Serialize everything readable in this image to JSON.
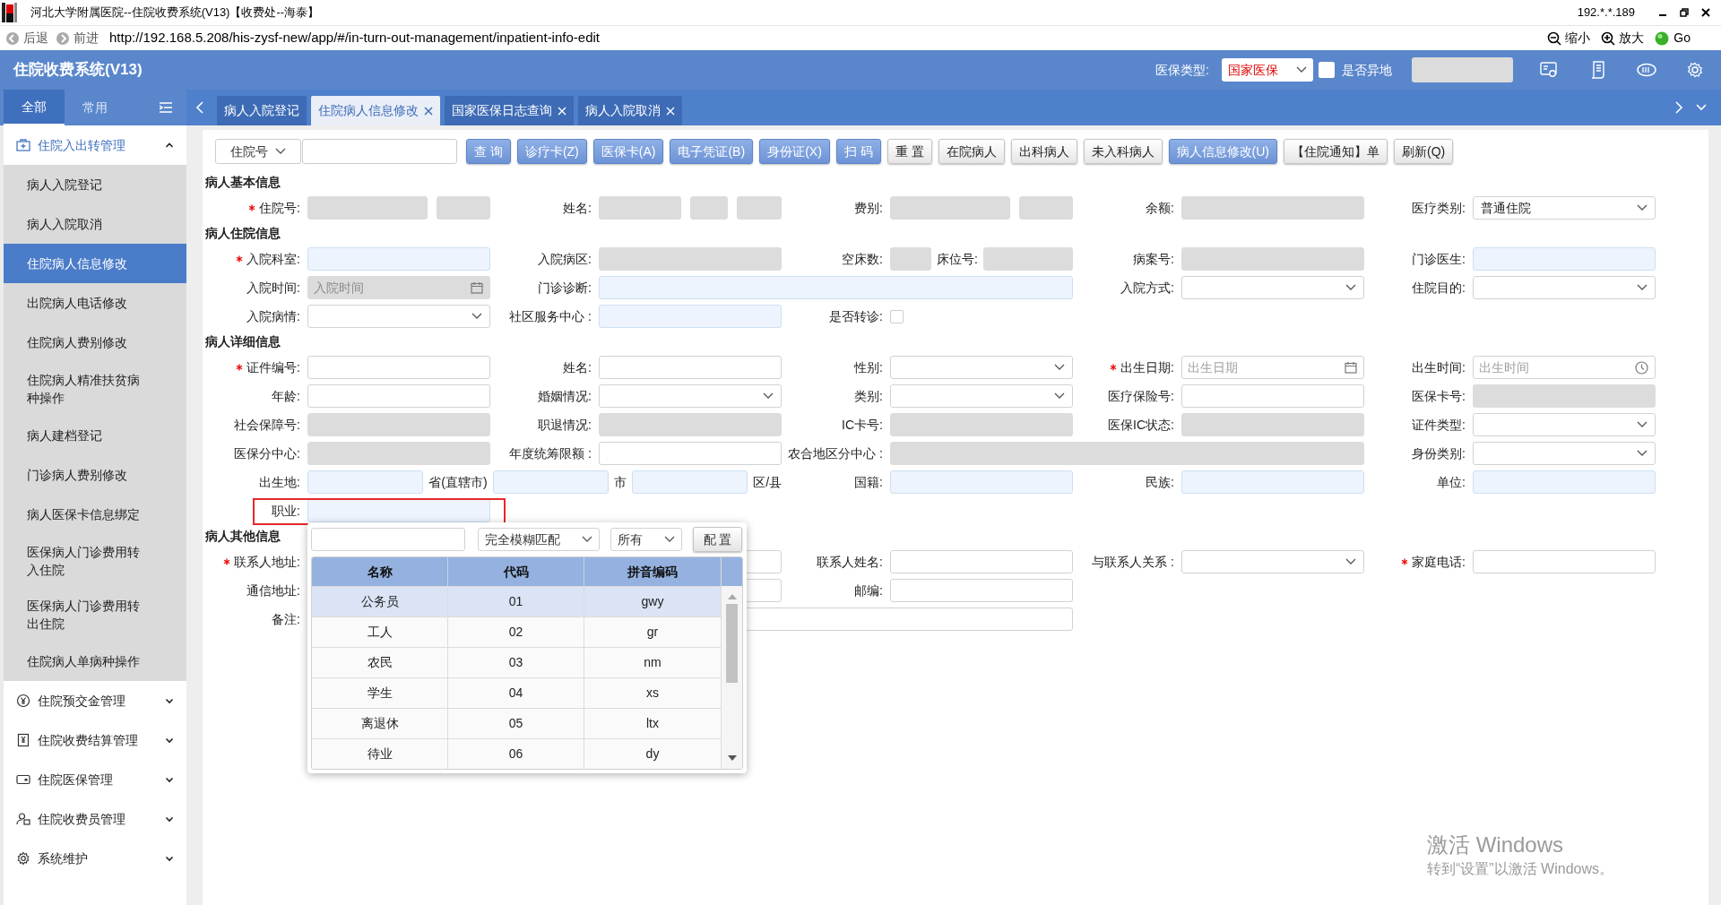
{
  "window": {
    "title": "河北大学附属医院--住院收费系统(V13)【收费处--海泰】",
    "ip": "192.*.*.189"
  },
  "browser": {
    "back": "后退",
    "forward": "前进",
    "url": "http://192.168.5.208/his-zysf-new/app/#/in-turn-out-management/inpatient-info-edit",
    "zoom_out": "缩小",
    "zoom_in": "放大",
    "go": "Go"
  },
  "app": {
    "title": "住院收费系统(V13)",
    "insurance_label": "医保类型:",
    "insurance_value": "国家医保",
    "remote_label": "是否异地",
    "remote_checked": false
  },
  "sidebar": {
    "tabs": [
      {
        "label": "全部",
        "selected": true
      },
      {
        "label": "常用",
        "selected": false
      }
    ],
    "groups": [
      {
        "label": "住院入出转管理",
        "expanded": true,
        "items": [
          {
            "label": "病人入院登记",
            "selected": false
          },
          {
            "label": "病人入院取消",
            "selected": false
          },
          {
            "label": "住院病人信息修改",
            "selected": true
          },
          {
            "label": "出院病人电话修改",
            "selected": false
          },
          {
            "label": "住院病人费别修改",
            "selected": false
          },
          {
            "label": "住院病人精准扶贫病种操作",
            "selected": false
          },
          {
            "label": "病人建档登记",
            "selected": false
          },
          {
            "label": "门诊病人费别修改",
            "selected": false
          },
          {
            "label": "病人医保卡信息绑定",
            "selected": false
          },
          {
            "label": "医保病人门诊费用转入住院",
            "selected": false
          },
          {
            "label": "医保病人门诊费用转出住院",
            "selected": false
          },
          {
            "label": "住院病人单病种操作",
            "selected": false
          }
        ]
      },
      {
        "label": "住院预交金管理",
        "expanded": false
      },
      {
        "label": "住院收费结算管理",
        "expanded": false
      },
      {
        "label": "住院医保管理",
        "expanded": false
      },
      {
        "label": "住院收费员管理",
        "expanded": false
      },
      {
        "label": "系统维护",
        "expanded": false
      }
    ]
  },
  "tabs": [
    {
      "label": "病人入院登记",
      "selected": false,
      "closable": false
    },
    {
      "label": "住院病人信息修改",
      "selected": true,
      "closable": true
    },
    {
      "label": "国家医保日志查询",
      "selected": false,
      "closable": true
    },
    {
      "label": "病人入院取消",
      "selected": false,
      "closable": true
    }
  ],
  "toolbar": {
    "search_by": "住院号",
    "buttons": [
      {
        "label": "查 询",
        "kind": "primary"
      },
      {
        "label": "诊疗卡(Z)",
        "kind": "primary"
      },
      {
        "label": "医保卡(A)",
        "kind": "primary"
      },
      {
        "label": "电子凭证(B)",
        "kind": "primary"
      },
      {
        "label": "身份证(X)",
        "kind": "primary"
      },
      {
        "label": "扫 码",
        "kind": "primary"
      },
      {
        "label": "重 置",
        "kind": "default"
      },
      {
        "label": "在院病人",
        "kind": "default"
      },
      {
        "label": "出科病人",
        "kind": "default"
      },
      {
        "label": "未入科病人",
        "kind": "default"
      },
      {
        "label": "病人信息修改(U)",
        "kind": "primary"
      },
      {
        "label": "【住院通知】单",
        "kind": "default"
      },
      {
        "label": "刷新(Q)",
        "kind": "default"
      }
    ]
  },
  "form": {
    "sections": [
      {
        "title": "病人基本信息",
        "rows": [
          [
            {
              "label": "住院号:",
              "required": true,
              "fields": [
                {
                  "kind": "input",
                  "disabled": true
                },
                {
                  "kind": "input",
                  "disabled": true
                }
              ]
            },
            {
              "label": "姓名:",
              "required": false,
              "fields": [
                {
                  "kind": "input",
                  "disabled": true
                },
                {
                  "kind": "input",
                  "disabled": true
                },
                {
                  "kind": "input",
                  "disabled": true
                }
              ]
            },
            {
              "label": "费别:",
              "required": false,
              "fields": [
                {
                  "kind": "input",
                  "disabled": true
                },
                {
                  "kind": "input",
                  "disabled": true
                }
              ]
            },
            {
              "label": "余额:",
              "required": false,
              "fields": [
                {
                  "kind": "input",
                  "disabled": true
                }
              ]
            },
            {
              "label": "医疗类别:",
              "required": false,
              "fields": [
                {
                  "kind": "select",
                  "value": "普通住院"
                }
              ]
            }
          ]
        ]
      },
      {
        "title": "病人住院信息",
        "rows": [
          [
            {
              "label": "入院科室:",
              "required": true,
              "fields": [
                {
                  "kind": "lookup"
                }
              ]
            },
            {
              "label": "入院病区:",
              "required": false,
              "fields": [
                {
                  "kind": "input",
                  "disabled": true
                }
              ]
            },
            {
              "label": "空床数:",
              "required": false,
              "fields": [
                {
                  "kind": "input",
                  "disabled": true
                },
                {
                  "kind": "text",
                  "text": "床位号:"
                },
                {
                  "kind": "input",
                  "disabled": true
                }
              ]
            },
            {
              "label": "病案号:",
              "required": false,
              "fields": [
                {
                  "kind": "input",
                  "disabled": true
                }
              ]
            },
            {
              "label": "门诊医生:",
              "required": false,
              "fields": [
                {
                  "kind": "lookup"
                }
              ]
            }
          ],
          [
            {
              "label": "入院时间:",
              "required": false,
              "fields": [
                {
                  "kind": "date",
                  "placeholder": "入院时间",
                  "disabled": true
                }
              ]
            },
            {
              "label": "门诊诊断:",
              "required": false,
              "fields": [
                {
                  "kind": "lookup"
                }
              ]
            },
            "",
            {
              "label": "入院方式:",
              "required": false,
              "fields": [
                {
                  "kind": "select"
                }
              ]
            },
            {
              "label": "住院目的:",
              "required": false,
              "fields": [
                {
                  "kind": "select"
                }
              ]
            }
          ],
          [
            {
              "label": "入院病情:",
              "required": false,
              "fields": [
                {
                  "kind": "select"
                }
              ]
            },
            {
              "label": "社区服务中心 :",
              "required": false,
              "fields": [
                {
                  "kind": "lookup"
                }
              ]
            },
            {
              "label": "是否转诊:",
              "required": false,
              "fields": [
                {
                  "kind": "checkbox",
                  "checked": false
                }
              ]
            }
          ]
        ]
      },
      {
        "title": "病人详细信息",
        "rows": [
          [
            {
              "label": "证件编号:",
              "required": true,
              "fields": [
                {
                  "kind": "input"
                }
              ]
            },
            {
              "label": "姓名:",
              "required": false,
              "fields": [
                {
                  "kind": "input"
                }
              ]
            },
            {
              "label": "性别:",
              "required": false,
              "fields": [
                {
                  "kind": "select"
                }
              ]
            },
            {
              "label": "出生日期:",
              "required": true,
              "fields": [
                {
                  "kind": "date",
                  "placeholder": "出生日期",
                  "disabled": false
                }
              ]
            },
            {
              "label": "出生时间:",
              "required": false,
              "fields": [
                {
                  "kind": "time",
                  "placeholder": "出生时间",
                  "disabled": false
                }
              ]
            }
          ],
          [
            {
              "label": "年龄:",
              "required": false,
              "fields": [
                {
                  "kind": "input"
                }
              ]
            },
            {
              "label": "婚姻情况:",
              "required": false,
              "fields": [
                {
                  "kind": "select"
                }
              ]
            },
            {
              "label": "类别:",
              "required": false,
              "fields": [
                {
                  "kind": "select"
                }
              ]
            },
            {
              "label": "医疗保险号:",
              "required": false,
              "fields": [
                {
                  "kind": "input"
                }
              ]
            },
            {
              "label": "医保卡号:",
              "required": false,
              "fields": [
                {
                  "kind": "input",
                  "disabled": true
                }
              ]
            }
          ],
          [
            {
              "label": "社会保障号:",
              "required": false,
              "fields": [
                {
                  "kind": "input",
                  "disabled": true
                }
              ]
            },
            {
              "label": "职退情况:",
              "required": false,
              "fields": [
                {
                  "kind": "input",
                  "disabled": true
                }
              ]
            },
            {
              "label": "IC卡号:",
              "required": false,
              "fields": [
                {
                  "kind": "input",
                  "disabled": true
                }
              ]
            },
            {
              "label": "医保IC状态:",
              "required": false,
              "fields": [
                {
                  "kind": "input",
                  "disabled": true
                }
              ]
            },
            {
              "label": "证件类型:",
              "required": false,
              "fields": [
                {
                  "kind": "select"
                }
              ]
            }
          ],
          [
            {
              "label": "医保分中心:",
              "required": false,
              "fields": [
                {
                  "kind": "input",
                  "disabled": true
                }
              ]
            },
            {
              "label": "年度统筹限额 :",
              "required": false,
              "fields": [
                {
                  "kind": "input"
                }
              ]
            },
            {
              "label": "农合地区分中心 :",
              "required": false,
              "fields": [
                {
                  "kind": "input",
                  "disabled": true
                }
              ]
            },
            "",
            {
              "label": "身份类别:",
              "required": false,
              "fields": [
                {
                  "kind": "select"
                }
              ]
            }
          ],
          [
            {
              "label": "出生地:",
              "required": false,
              "fields": [
                {
                  "kind": "lookup"
                },
                {
                  "kind": "text",
                  "text": "省(直辖市)"
                },
                {
                  "kind": "lookup"
                },
                {
                  "kind": "text",
                  "text": "市"
                },
                {
                  "kind": "lookup"
                },
                {
                  "kind": "text",
                  "text": "区/县"
                }
              ]
            },
            "",
            {
              "label": "国籍:",
              "required": false,
              "fields": [
                {
                  "kind": "lookup"
                }
              ]
            },
            {
              "label": "民族:",
              "required": false,
              "fields": [
                {
                  "kind": "lookup"
                }
              ]
            },
            {
              "label": "单位:",
              "required": false,
              "fields": [
                {
                  "kind": "lookup"
                }
              ]
            }
          ],
          [
            {
              "label": "职业:",
              "required": false,
              "highlighted": true,
              "fields": [
                {
                  "kind": "lookup"
                }
              ]
            }
          ]
        ]
      },
      {
        "title": "病人其他信息",
        "rows": [
          [
            {
              "label": "联系人地址:",
              "required": true,
              "fields": [
                {
                  "kind": "input"
                }
              ]
            },
            "",
            {
              "label": "联系人姓名:",
              "required": false,
              "fields": [
                {
                  "kind": "input"
                }
              ]
            },
            {
              "label": "与联系人关系 :",
              "required": false,
              "fields": [
                {
                  "kind": "select"
                }
              ]
            },
            {
              "label": "家庭电话:",
              "required": true,
              "fields": [
                {
                  "kind": "input"
                }
              ]
            }
          ],
          [
            {
              "label": "通信地址:",
              "required": false,
              "fields": [
                {
                  "kind": "input"
                }
              ]
            },
            "",
            {
              "label": "邮编:",
              "required": false,
              "fields": [
                {
                  "kind": "input"
                }
              ]
            }
          ],
          [
            {
              "label": "备注:",
              "required": false,
              "fields": [
                {
                  "kind": "input"
                }
              ]
            },
            "",
            ""
          ]
        ]
      }
    ]
  },
  "popup": {
    "match_mode": "完全模糊匹配",
    "scope": "所有",
    "config_button": "配 置",
    "columns": [
      "名称",
      "代码",
      "拼音编码"
    ],
    "rows": [
      {
        "cells": [
          "公务员",
          "01",
          "gwy"
        ],
        "selected": true
      },
      {
        "cells": [
          "工人",
          "02",
          "gr"
        ],
        "selected": false
      },
      {
        "cells": [
          "农民",
          "03",
          "nm"
        ],
        "selected": false
      },
      {
        "cells": [
          "学生",
          "04",
          "xs"
        ],
        "selected": false
      },
      {
        "cells": [
          "离退休",
          "05",
          "ltx"
        ],
        "selected": false
      },
      {
        "cells": [
          "待业",
          "06",
          "dy"
        ],
        "selected": false
      }
    ]
  },
  "activation": {
    "title": "激活 Windows",
    "text": "转到“设置”以激活 Windows。"
  }
}
